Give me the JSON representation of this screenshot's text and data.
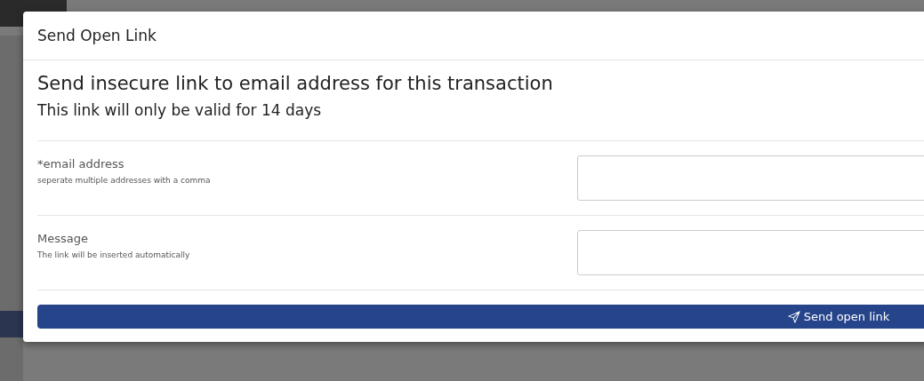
{
  "dialog": {
    "title": "Send Open Link",
    "heading": "Send insecure link to email address for this transaction",
    "subheading": "This link will only be valid for 14 days",
    "fields": [
      {
        "label": "*email address",
        "hint": "seperate multiple addresses with a comma"
      },
      {
        "label": "Message",
        "hint": "The link will be inserted automatically"
      }
    ],
    "submit_button": "Send open link"
  }
}
